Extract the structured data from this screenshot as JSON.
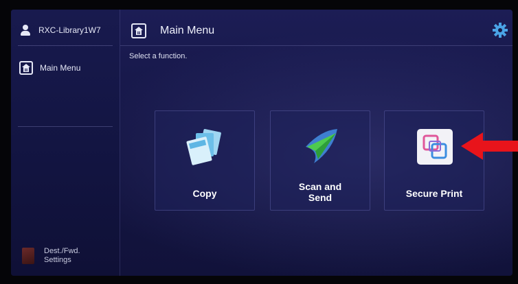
{
  "sidebar": {
    "user": {
      "name": "RXC-Library1W7",
      "icon": "user-icon"
    },
    "items": [
      {
        "label": "Main Menu",
        "icon": "home-icon"
      }
    ],
    "footer": {
      "line1": "Dest./Fwd.",
      "line2": "Settings",
      "icon": "settings-book-icon"
    }
  },
  "header": {
    "title": "Main Menu",
    "home_icon": "home-icon",
    "settings_icon": "gear-icon"
  },
  "subtitle": "Select a function.",
  "tiles": [
    {
      "label_line1": "Copy",
      "icon": "copy-icon"
    },
    {
      "label_line1": "Scan and",
      "label_line2": "Send",
      "icon": "paper-plane-icon"
    },
    {
      "label_line1": "Secure Print",
      "icon": "secure-print-icon"
    }
  ],
  "annotation": {
    "type": "arrow",
    "color": "#e8141b",
    "points_to": "secure-print-tile"
  }
}
